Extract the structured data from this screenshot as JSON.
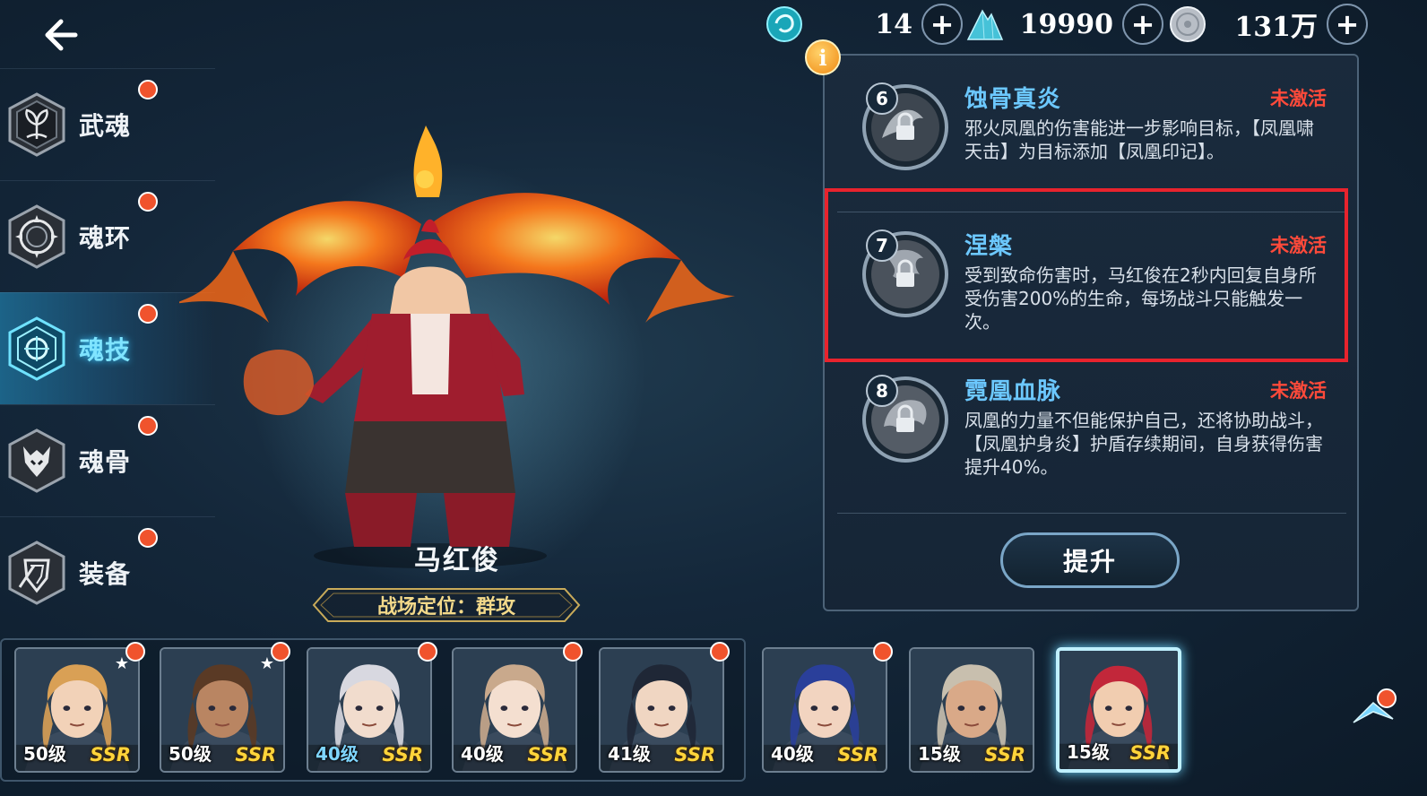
{
  "nav": {
    "items": [
      {
        "label": "武魂",
        "icon": "sprout-emblem-icon",
        "active": false,
        "badge": true
      },
      {
        "label": "魂环",
        "icon": "ring-emblem-icon",
        "active": false,
        "badge": true
      },
      {
        "label": "魂技",
        "icon": "skill-emblem-icon",
        "active": true,
        "badge": true
      },
      {
        "label": "魂骨",
        "icon": "bone-emblem-icon",
        "active": false,
        "badge": true
      },
      {
        "label": "装备",
        "icon": "armor-emblem-icon",
        "active": false,
        "badge": true
      }
    ]
  },
  "currency": [
    {
      "icon": "soul-orb-icon",
      "value": "14"
    },
    {
      "icon": "crystal-pile-icon",
      "value": "19990"
    },
    {
      "icon": "silver-coin-icon",
      "value": "131万"
    }
  ],
  "character": {
    "name": "马红俊",
    "role": "战场定位：群攻"
  },
  "skills": [
    {
      "num": "6",
      "name": "蚀骨真炎",
      "status": "未激活",
      "desc": "邪火凤凰的伤害能进一步影响目标，【凤凰啸天击】为目标添加【凤凰印记】。"
    },
    {
      "num": "7",
      "name": "涅槃",
      "status": "未激活",
      "desc": "受到致命伤害时，马红俊在2秒内回复自身所受伤害200%的生命，每场战斗只能触发一次。"
    },
    {
      "num": "8",
      "name": "霓凰血脉",
      "status": "未激活",
      "desc": "凤凰的力量不但能保护自己，还将协助战斗，【凤凰护身炎】护盾存续期间，自身获得伤害提升40%。"
    }
  ],
  "upgrade_label": "提升",
  "roster": [
    {
      "level": "50级",
      "rarity": "SSR",
      "badge": true,
      "star": true,
      "hair": "#d9a055",
      "skin": "#f2d2b8"
    },
    {
      "level": "50级",
      "rarity": "SSR",
      "badge": true,
      "star": true,
      "hair": "#5a3a25",
      "skin": "#b98562"
    },
    {
      "level": "40级",
      "rarity": "SSR",
      "badge": true,
      "star": false,
      "hair": "#d8d8e0",
      "skin": "#f1dccd"
    },
    {
      "level": "40级",
      "rarity": "SSR",
      "badge": true,
      "star": false,
      "hair": "#c9a98c",
      "skin": "#f4dfd0"
    },
    {
      "level": "41级",
      "rarity": "SSR",
      "badge": true,
      "star": false,
      "hair": "#1f2736",
      "skin": "#f0d6c2"
    },
    {
      "level": "40级",
      "rarity": "SSR",
      "badge": true,
      "star": false,
      "hair": "#2a3f9a",
      "skin": "#f2d4c0"
    },
    {
      "level": "15级",
      "rarity": "SSR",
      "badge": false,
      "star": false,
      "hair": "#c8bfae",
      "skin": "#d9a988"
    },
    {
      "level": "15级",
      "rarity": "SSR",
      "badge": false,
      "star": false,
      "hair": "#c2273a",
      "skin": "#f1cdb0",
      "selected": true
    }
  ],
  "colors": {
    "accent": "#6cc8ff",
    "inactive_status": "#ff4a3a",
    "badge": "#f0532d",
    "rarity": "#ffd43a",
    "highlight": "#e8232d"
  }
}
